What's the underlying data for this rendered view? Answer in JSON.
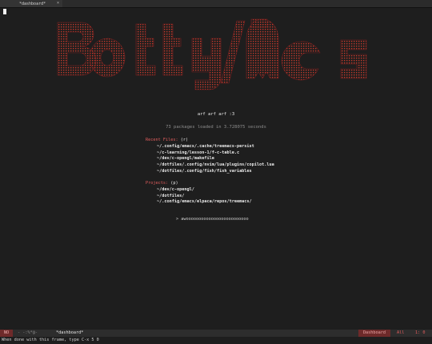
{
  "tab": {
    "title": "*dashboard*",
    "close_glyph": "×"
  },
  "dashboard": {
    "subtitle": "arf arf arf :3",
    "loaded": "73 packages loaded in 3.728075 seconds",
    "recent": {
      "title": "Recent Files:",
      "key": "(r)",
      "items": [
        "~/.config/emacs/.cache/treemacs-persist",
        "~/c-learning/lesson-1/f-c-table.c",
        "~/dev/c-opengl/makefile",
        "~/dotfiles/.config/nvim/lua/plugins/copilot.lua",
        "~/dotfiles/.config/fish/fish_variables"
      ]
    },
    "projects": {
      "title": "Projects:",
      "key": "(p)",
      "items": [
        "~/dev/c-opengl/",
        "~/dotfiles/",
        "~/.config/emacs/elpaca/repos/treemacs/"
      ]
    },
    "footer": "> awooooooooooooooooooooooooo"
  },
  "modeline": {
    "state": "NO",
    "flags": "-  -:%*@-",
    "buffer": "*dashboard*",
    "mode": "Dashboard",
    "position": "All",
    "line": "1: 0"
  },
  "echo_area": "When done with this frame, type C-x 5 0",
  "colors": {
    "background": "#1e1e1e",
    "banner_red": "#c0392b",
    "accent_red": "#e25d5d",
    "muted": "#8d8d8d"
  }
}
